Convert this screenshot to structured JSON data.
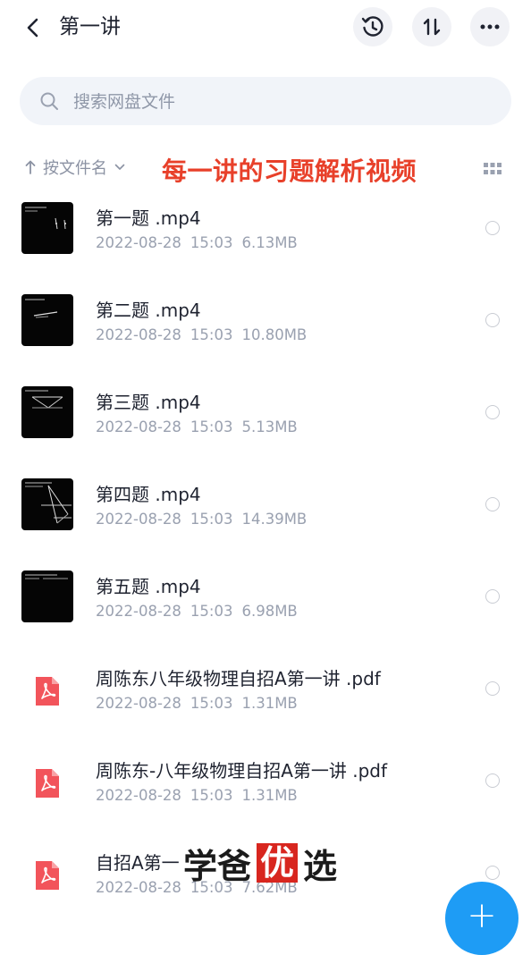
{
  "header": {
    "title": "第一讲",
    "back_icon": "chevron-left-icon",
    "history_icon": "history-icon",
    "sort_icon": "sort-arrows-icon",
    "more_icon": "more-horizontal-icon"
  },
  "search": {
    "placeholder": "搜索网盘文件",
    "value": ""
  },
  "sortbar": {
    "label": "按文件名",
    "grid_icon": "grid-view-icon"
  },
  "overlay_note": "每一讲的习题解析视频",
  "files": [
    {
      "name": "第一题 .mp4",
      "date": "2022-08-28",
      "time": "15:03",
      "size": "6.13MB",
      "type": "video"
    },
    {
      "name": "第二题 .mp4",
      "date": "2022-08-28",
      "time": "15:03",
      "size": "10.80MB",
      "type": "video"
    },
    {
      "name": "第三题 .mp4",
      "date": "2022-08-28",
      "time": "15:03",
      "size": "5.13MB",
      "type": "video"
    },
    {
      "name": "第四题 .mp4",
      "date": "2022-08-28",
      "time": "15:03",
      "size": "14.39MB",
      "type": "video"
    },
    {
      "name": "第五题 .mp4",
      "date": "2022-08-28",
      "time": "15:03",
      "size": "6.98MB",
      "type": "video"
    },
    {
      "name": "周陈东八年级物理自招A第一讲 .pdf",
      "date": "2022-08-28",
      "time": "15:03",
      "size": "1.31MB",
      "type": "pdf"
    },
    {
      "name": "周陈东-八年级物理自招A第一讲 .pdf",
      "date": "2022-08-28",
      "time": "15:03",
      "size": "1.31MB",
      "type": "pdf"
    },
    {
      "name": "自招A第一",
      "date": "2022-08-28",
      "time": "15:03",
      "size": "7.62MB",
      "type": "pdf"
    }
  ],
  "watermark": {
    "part1": "学爸",
    "part2": "优",
    "part3": "选"
  },
  "fab": {
    "label": "+"
  },
  "colors": {
    "accent": "#1e9cf5",
    "overlay_text": "#e8402a",
    "pdf_red": "#f2545b",
    "meta_gray": "#9aa1b0"
  }
}
